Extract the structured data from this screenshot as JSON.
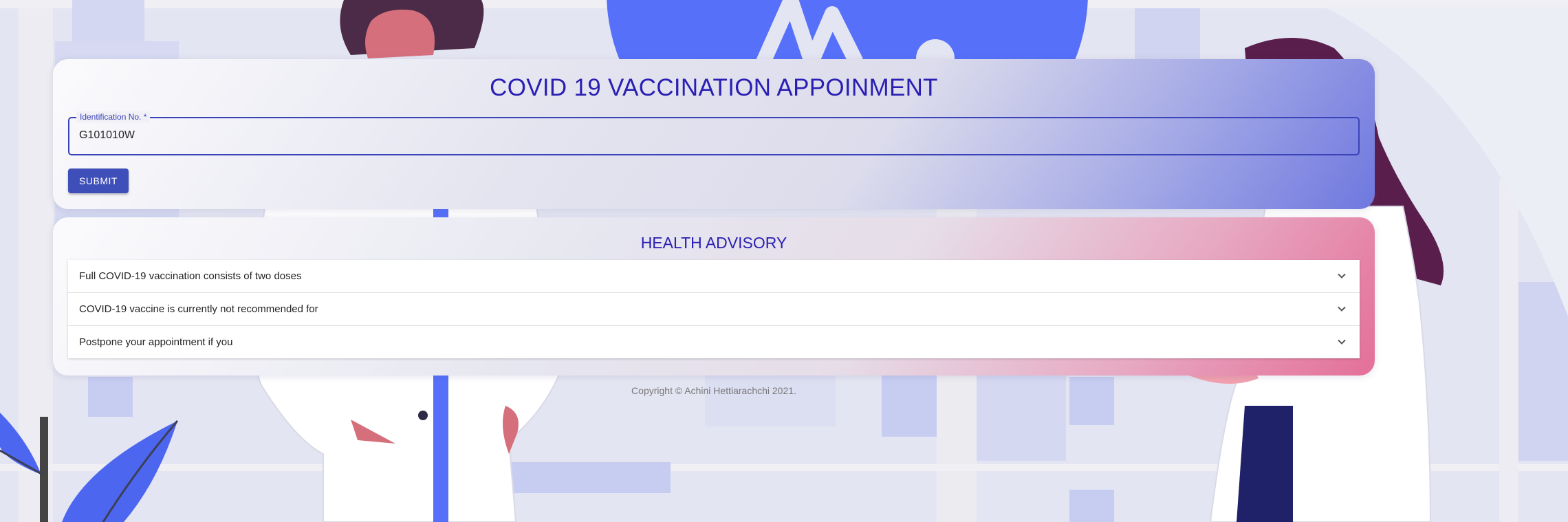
{
  "appointment": {
    "title": "COVID 19 VACCINATION APPOINMENT",
    "id_field": {
      "label": "Identification No. *",
      "value": "G101010W"
    },
    "submit_label": "SUBMIT"
  },
  "advisory": {
    "title": "HEALTH ADVISORY",
    "items": [
      {
        "label": "Full COVID-19 vaccination consists of two doses",
        "icon": "chevron-down-icon"
      },
      {
        "label": "COVID-19 vaccine is currently not recommended for",
        "icon": "chevron-down-icon"
      },
      {
        "label": "Postpone your appointment if you",
        "icon": "chevron-down-icon"
      }
    ]
  },
  "footer": {
    "copyright": "Copyright © Achini Hettiarachchi 2021."
  },
  "colors": {
    "accent": "#3f4fb9",
    "title": "#2a1fb3",
    "illustration_blue": "#5670fa",
    "illustration_pink": "#e46f98"
  }
}
